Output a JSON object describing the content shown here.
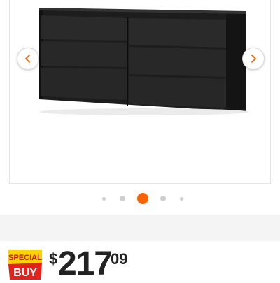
{
  "gallery": {
    "image_subject": "black six-drawer dresser",
    "image_count": 5,
    "active_index": 2,
    "prev_icon": "chevron-left-icon",
    "next_icon": "chevron-right-icon"
  },
  "promo": {
    "badge_line1": "SPECIAL",
    "badge_line2": "BUY"
  },
  "price": {
    "currency_symbol": "$",
    "dollars": "217",
    "cents": "09"
  },
  "colors": {
    "accent": "#f96302",
    "arrow": "#f96302",
    "badge_yellow": "#ffd200",
    "badge_red": "#e4211b"
  }
}
